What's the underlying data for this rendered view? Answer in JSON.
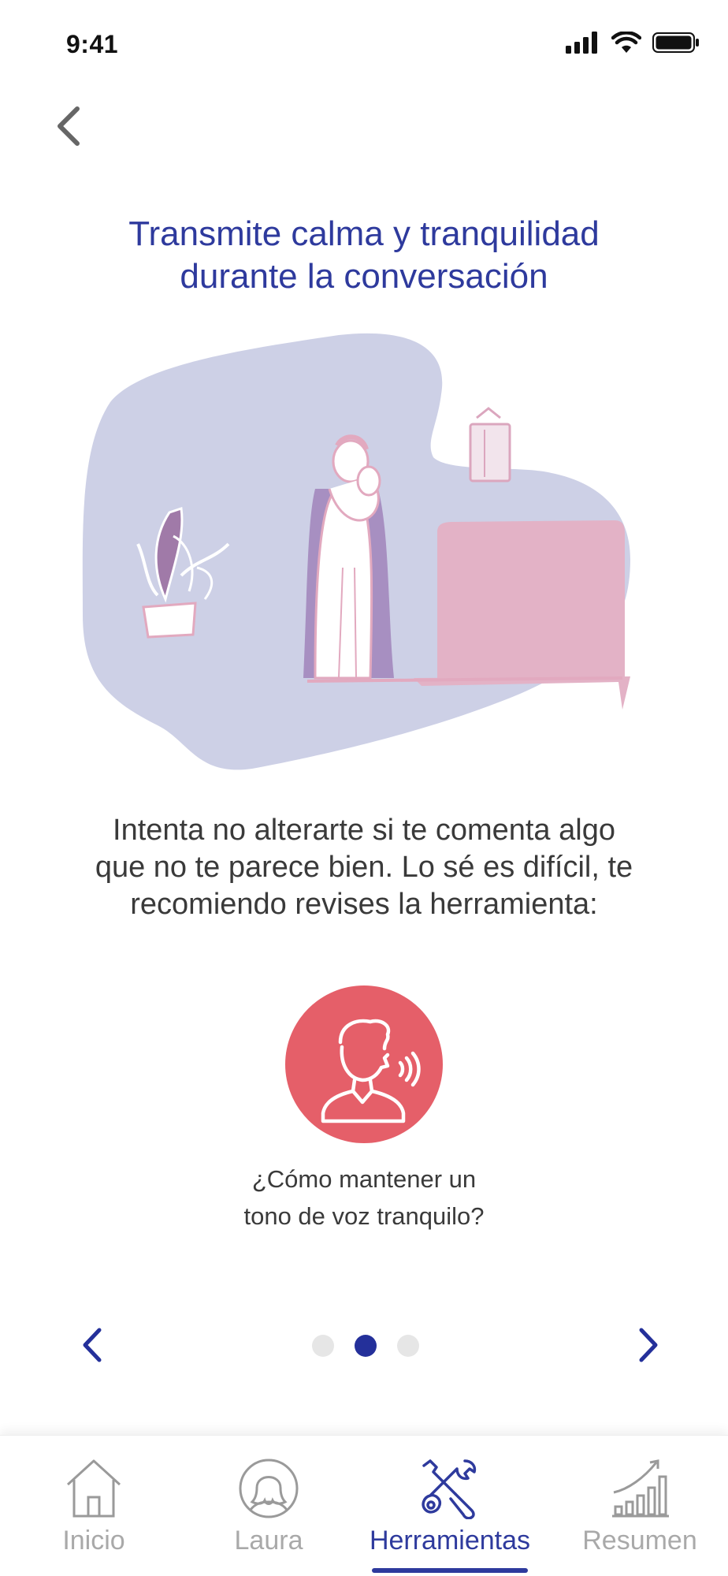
{
  "status_bar": {
    "time": "9:41"
  },
  "page": {
    "title_line1": "Transmite calma y tranquilidad",
    "title_line2": "durante la conversación",
    "body_line1": "Intenta no alterarte si te comenta algo",
    "body_line2": "que no te parece bien. Lo sé es difícil, te",
    "body_line3": "recomiendo revises la herramienta:"
  },
  "tool": {
    "label_line1": "¿Cómo mantener un",
    "label_line2": "tono de voz tranquilo?",
    "icon": "speaking-person-icon"
  },
  "pager": {
    "pages": 3,
    "current": 2
  },
  "tabs": [
    {
      "label": "Inicio",
      "icon": "home-icon",
      "active": false
    },
    {
      "label": "Laura",
      "icon": "person-avatar-icon",
      "active": false
    },
    {
      "label": "Herramientas",
      "icon": "tools-icon",
      "active": true
    },
    {
      "label": "Resumen",
      "icon": "chart-growth-icon",
      "active": false
    }
  ],
  "colors": {
    "accent": "#2e3a9d",
    "tool_circle": "#e55f69",
    "blob": "#cdd0e6",
    "pink": "#e3b2c6",
    "dot_active": "#24309a",
    "dot_inactive": "#e6e6e6"
  }
}
